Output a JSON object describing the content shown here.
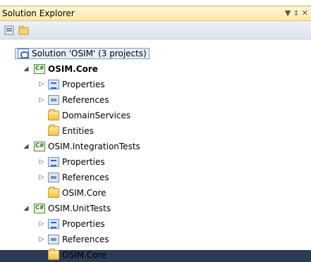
{
  "window": {
    "title": "Solution Explorer",
    "buttons": [
      "▼",
      "‡",
      "✕"
    ]
  },
  "toolbar": {
    "tools": [
      "properties-icon",
      "show-all-files-icon"
    ]
  },
  "tree": [
    {
      "label": "Solution 'OSIM' (3 projects)",
      "icon": "solution-icon",
      "expander": ""
    },
    {
      "label": "OSIM.Core",
      "icon": "csharp-project-icon",
      "expander": "◢"
    },
    {
      "label": "Properties",
      "icon": "properties-icon",
      "expander": "▷"
    },
    {
      "label": "References",
      "icon": "references-icon",
      "expander": "▷"
    },
    {
      "label": "DomainServices",
      "icon": "folder-icon",
      "expander": ""
    },
    {
      "label": "Entities",
      "icon": "folder-icon",
      "expander": ""
    },
    {
      "label": "OSIM.IntegrationTests",
      "icon": "csharp-project-icon",
      "expander": "◢"
    },
    {
      "label": "Properties",
      "icon": "properties-icon",
      "expander": "▷"
    },
    {
      "label": "References",
      "icon": "references-icon",
      "expander": "▷"
    },
    {
      "label": "OSIM.Core",
      "icon": "folder-icon",
      "expander": ""
    },
    {
      "label": "OSIM.UnitTests",
      "icon": "csharp-project-icon",
      "expander": "◢"
    },
    {
      "label": "Properties",
      "icon": "properties-icon",
      "expander": "▷"
    },
    {
      "label": "References",
      "icon": "references-icon",
      "expander": "▷"
    },
    {
      "label": "OSIM.Core",
      "icon": "folder-icon",
      "expander": ""
    }
  ]
}
